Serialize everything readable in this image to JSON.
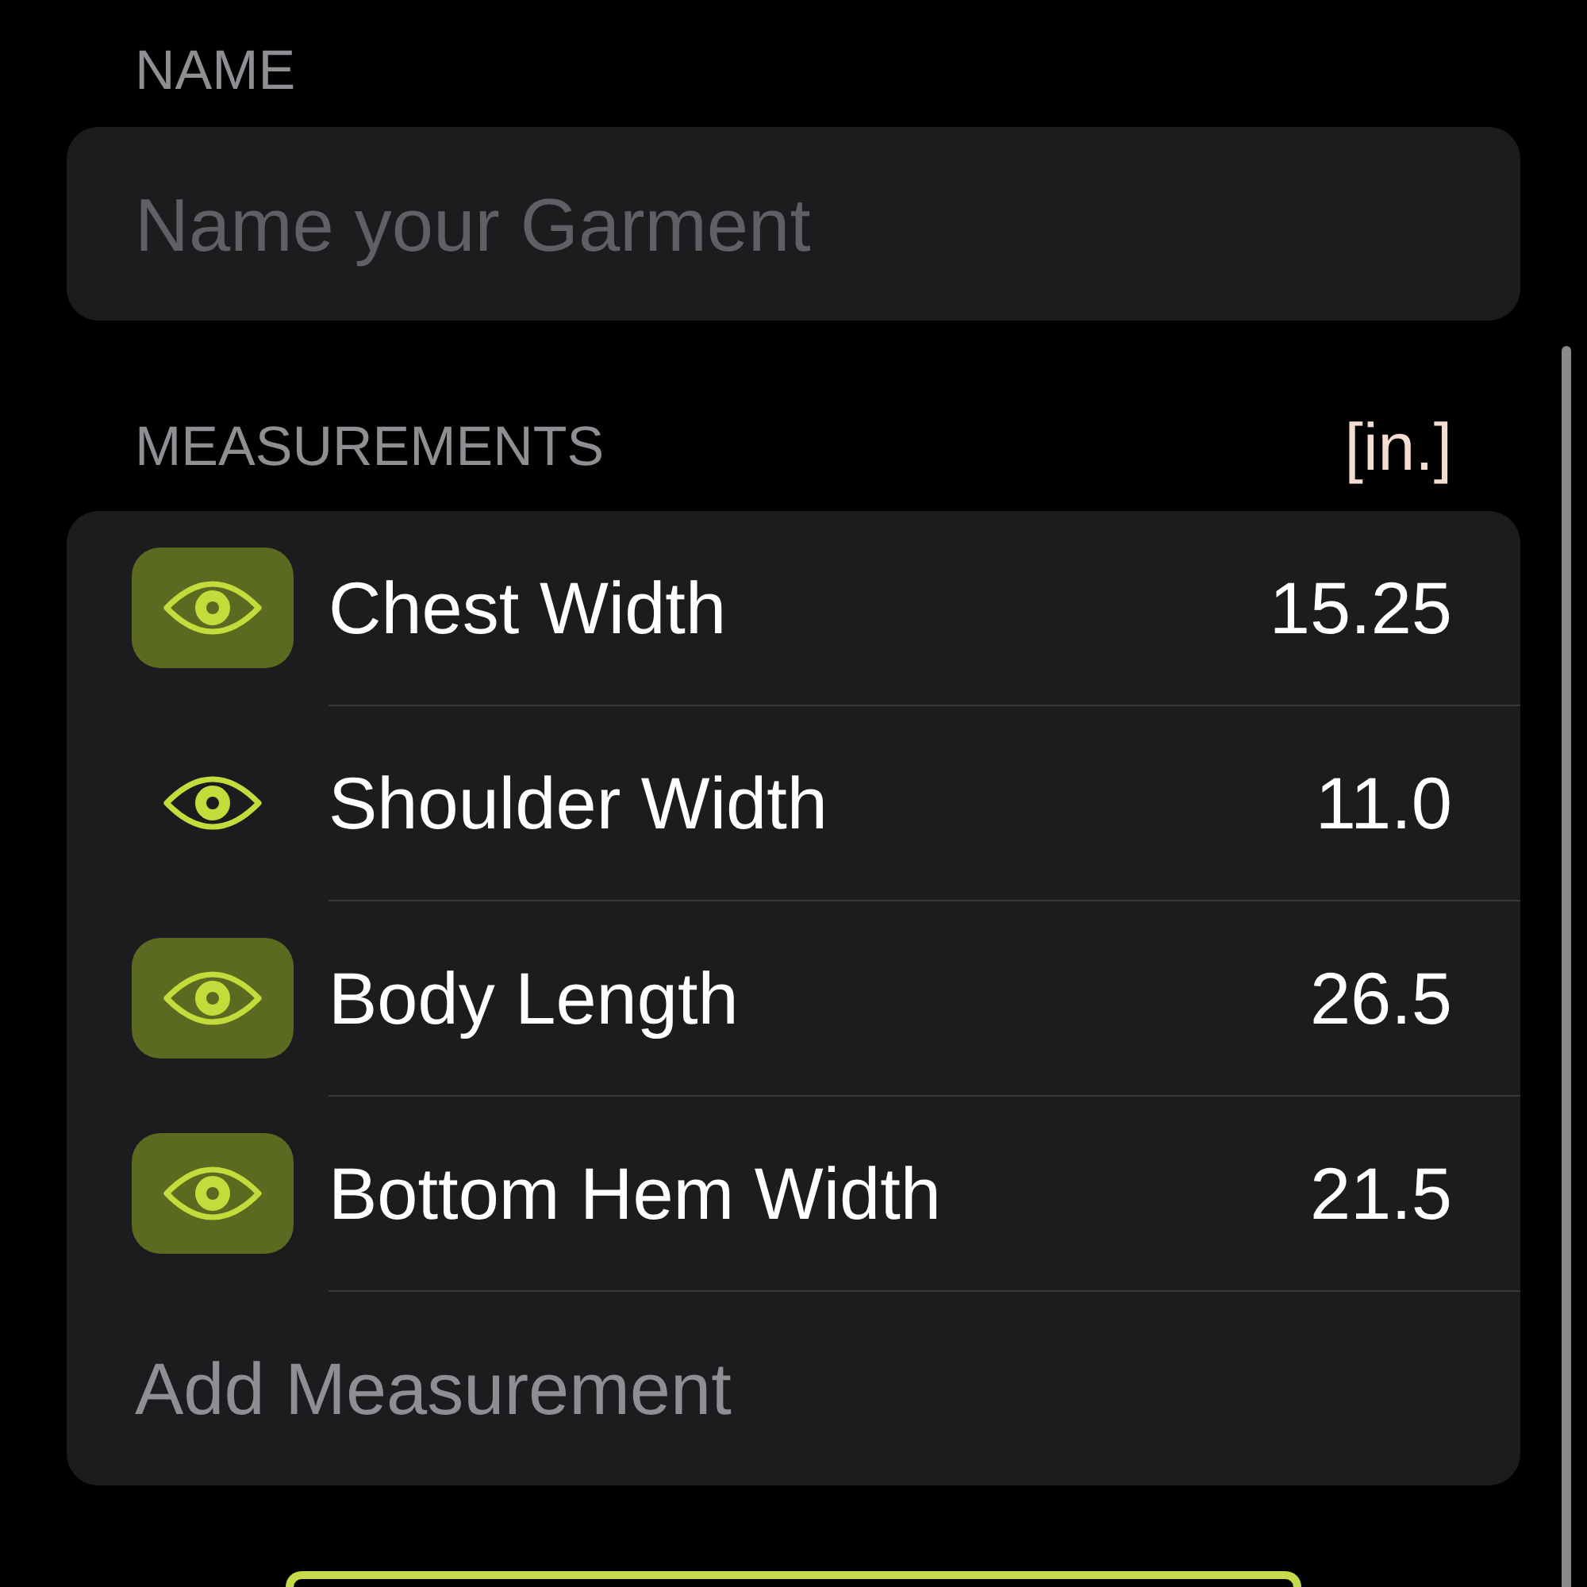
{
  "name_section": {
    "label": "NAME",
    "field": {
      "placeholder": "Name your Garment"
    }
  },
  "measurements": {
    "label": "MEASUREMENTS",
    "unit": "[in.]",
    "items": [
      {
        "name": "Chest Width",
        "value": "15.25",
        "selected": true
      },
      {
        "name": "Shoulder Width",
        "value": "11.0",
        "selected": false
      },
      {
        "name": "Body Length",
        "value": "26.5",
        "selected": true
      },
      {
        "name": "Bottom Hem Width",
        "value": "21.5",
        "selected": true
      }
    ],
    "add_action": "Add Measurement"
  }
}
